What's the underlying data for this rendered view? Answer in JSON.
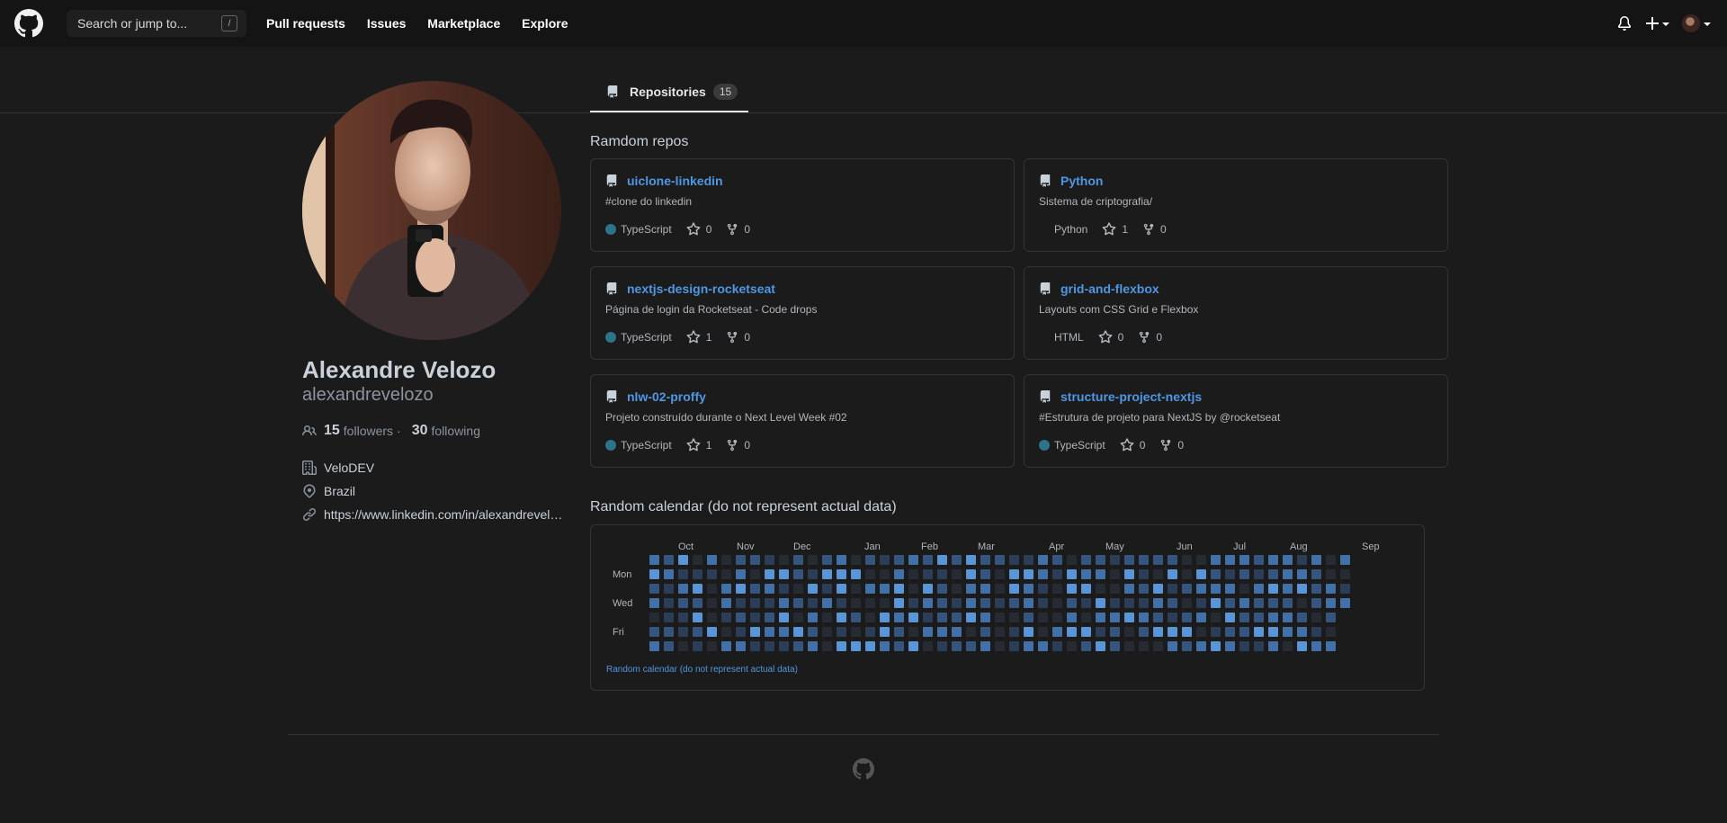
{
  "header": {
    "search_placeholder": "Search or jump to...",
    "search_shortcut": "/",
    "nav": [
      "Pull requests",
      "Issues",
      "Marketplace",
      "Explore"
    ]
  },
  "tabs": [
    {
      "label": "Repositories",
      "count": "15"
    }
  ],
  "profile": {
    "name": "Alexandre Velozo",
    "login": "alexandrevelozo",
    "followers": "15",
    "followers_label": "followers",
    "following": "30",
    "following_label": "following",
    "separator": "·",
    "company": "VeloDEV",
    "location": "Brazil",
    "website": "https://www.linkedin.com/in/alexandrevelozo"
  },
  "repos_title": "Ramdom repos",
  "repos": [
    {
      "name": "uiclone-linkedin",
      "description": "#clone do linkedin",
      "language": "TypeScript",
      "lang_color": "#2b7489",
      "stars": "0",
      "forks": "0"
    },
    {
      "name": "Python",
      "description": "Sistema de criptografia/",
      "language": "Python",
      "lang_color": "",
      "stars": "1",
      "forks": "0"
    },
    {
      "name": "nextjs-design-rocketseat",
      "description": "Página de login da Rocketseat - Code drops",
      "language": "TypeScript",
      "lang_color": "#2b7489",
      "stars": "1",
      "forks": "0"
    },
    {
      "name": "grid-and-flexbox",
      "description": "Layouts com CSS Grid e Flexbox",
      "language": "HTML",
      "lang_color": "",
      "stars": "0",
      "forks": "0"
    },
    {
      "name": "nlw-02-proffy",
      "description": "Projeto construído durante o Next Level Week #02",
      "language": "TypeScript",
      "lang_color": "#2b7489",
      "stars": "1",
      "forks": "0"
    },
    {
      "name": "structure-project-nextjs",
      "description": "#Estrutura de projeto para NextJS by @rocketseat",
      "language": "TypeScript",
      "lang_color": "#2b7489",
      "stars": "0",
      "forks": "0"
    }
  ],
  "calendar": {
    "title": "Random calendar (do not represent actual data)",
    "footer": "Random calendar (do not represent actual data)",
    "months": [
      "Oct",
      "Nov",
      "Dec",
      "Jan",
      "Feb",
      "Mar",
      "Apr",
      "May",
      "Jun",
      "Jul",
      "Aug",
      "Sep"
    ],
    "day_labels": [
      "Mon",
      "Wed",
      "Fri"
    ],
    "colors": [
      "#262b33",
      "#2c3d57",
      "#36557e",
      "#4271a8",
      "#5a95d8"
    ],
    "levels": "3423023231112241321100142421310004000331032341213202114114312310413431220204201413232413000344141404002042030014103044323443223001404214313041222312001232443340222323232001000144201114332433311003210003104423402341042230431410013222431400212132020432402412143002024204313033234014313242332032212132241324234333323301340234322201300332033013"
  }
}
